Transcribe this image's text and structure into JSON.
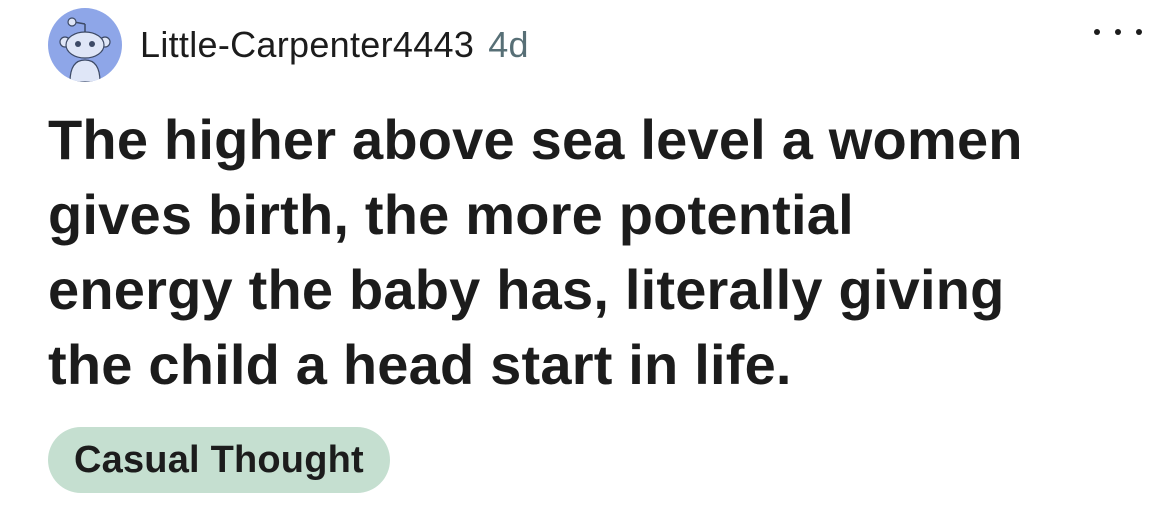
{
  "post": {
    "author": "Little-Carpenter4443",
    "age": "4d",
    "title_lines": [
      "The higher above sea level a women",
      "gives birth, the more potential",
      "energy the baby has, literally giving",
      "the child a head start in life."
    ],
    "flair": "Casual Thought"
  },
  "icons": {
    "avatar": "snoo-avatar-icon",
    "menu": "more-options-icon"
  },
  "colors": {
    "avatar_bg": "#8ea6e8",
    "flair_bg": "#c5dfd0",
    "meta_gray": "#576f76",
    "text": "#1c1c1c"
  }
}
